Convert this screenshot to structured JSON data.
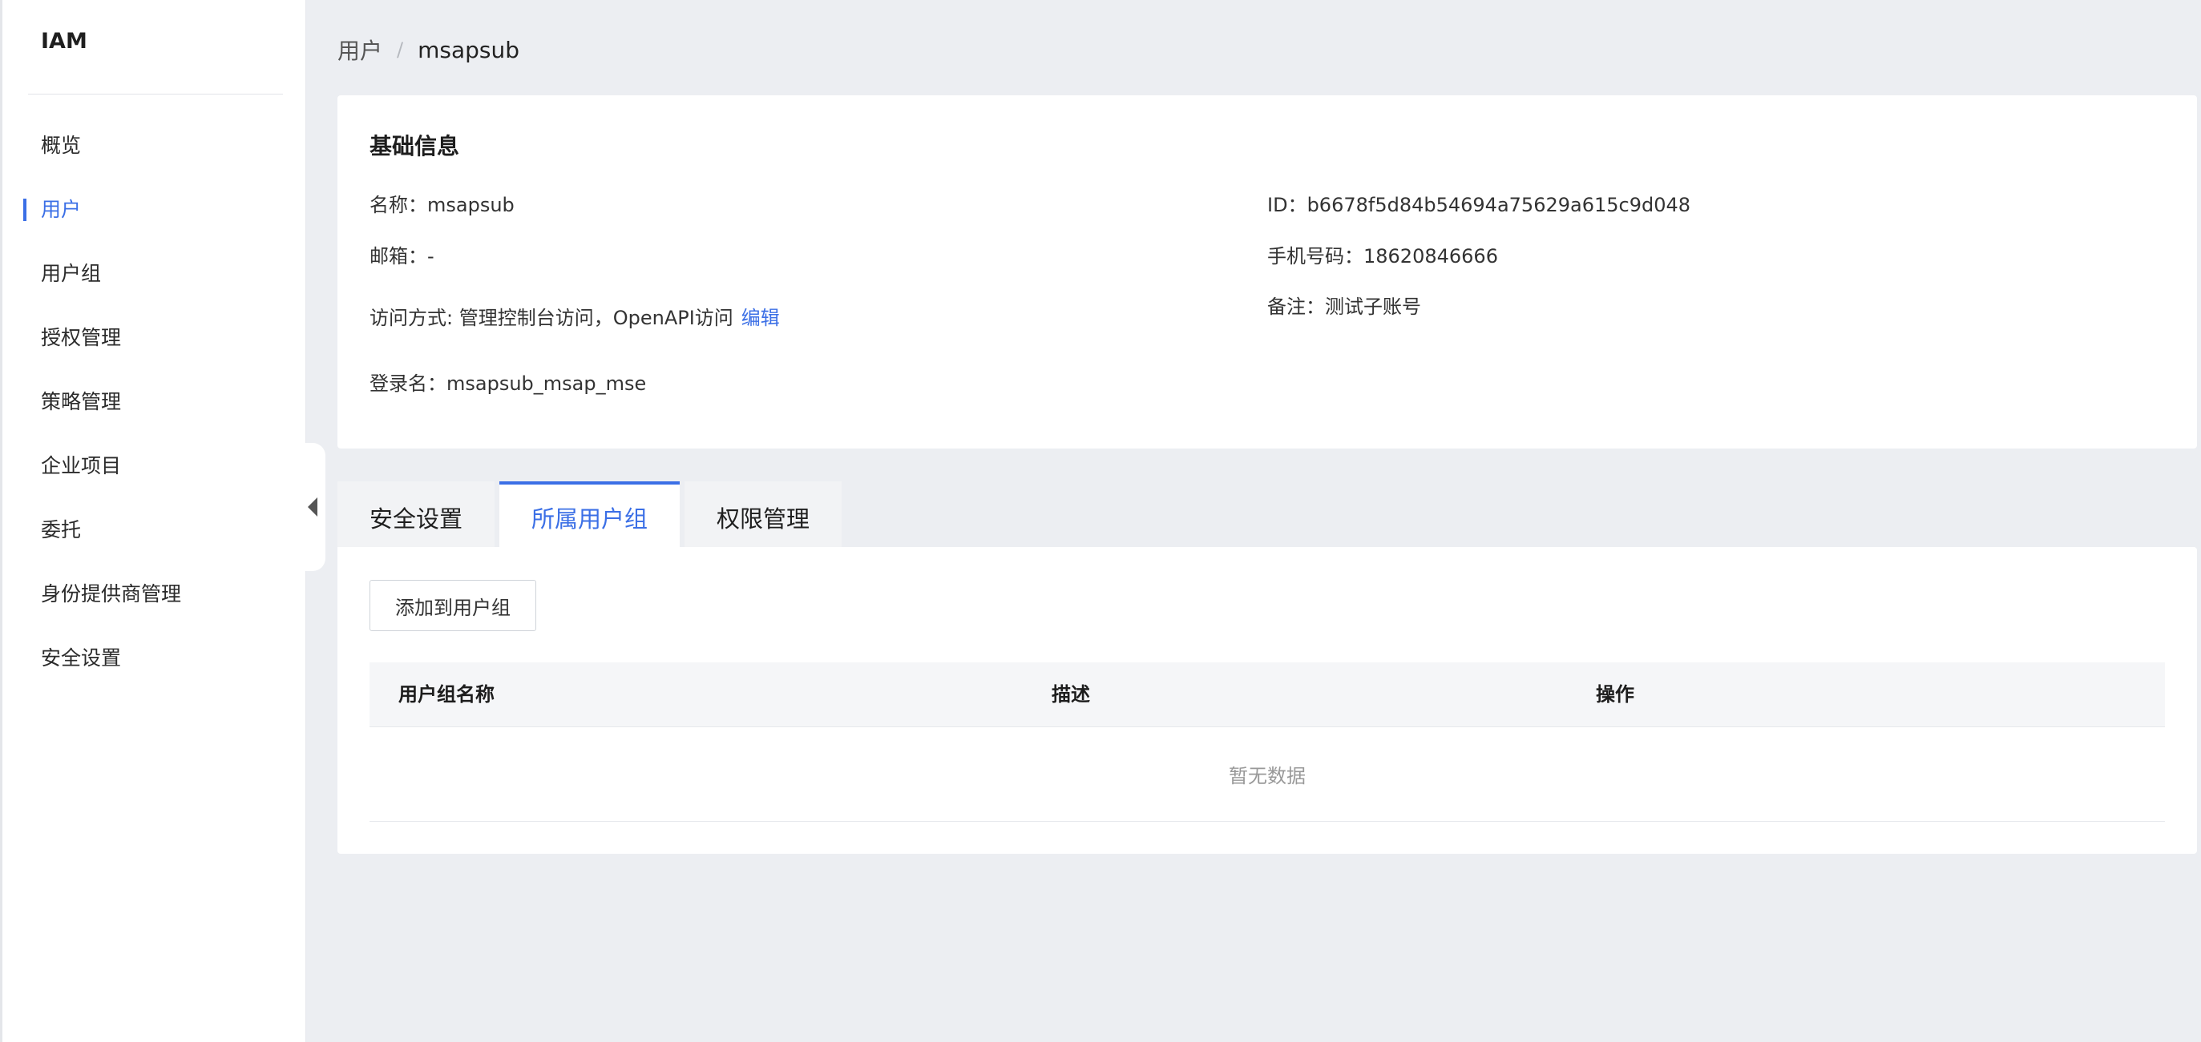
{
  "app": {
    "title": "IAM"
  },
  "sidebar": {
    "items": [
      {
        "label": "概览"
      },
      {
        "label": "用户"
      },
      {
        "label": "用户组"
      },
      {
        "label": "授权管理"
      },
      {
        "label": "策略管理"
      },
      {
        "label": "企业项目"
      },
      {
        "label": "委托"
      },
      {
        "label": "身份提供商管理"
      },
      {
        "label": "安全设置"
      }
    ],
    "active_index": 1,
    "collapse_icon": "caret-left-icon"
  },
  "breadcrumb": {
    "parent": "用户",
    "separator": "/",
    "current": "msapsub"
  },
  "basic_info": {
    "title": "基础信息",
    "name_label": "名称：",
    "name_value": "msapsub",
    "email_label": "邮箱：",
    "email_value": "-",
    "access_label": "访问方式: ",
    "access_value": "管理控制台访问，OpenAPI访问",
    "access_edit": "编辑",
    "login_label": "登录名：",
    "login_value": "msapsub_msap_mse",
    "id_label": "ID：",
    "id_value": "b6678f5d84b54694a75629a615c9d048",
    "phone_label": "手机号码：",
    "phone_value": "18620846666",
    "remark_label": "备注：",
    "remark_value": "测试子账号"
  },
  "tabs": [
    {
      "label": "安全设置"
    },
    {
      "label": "所属用户组"
    },
    {
      "label": "权限管理"
    }
  ],
  "active_tab": 1,
  "group_panel": {
    "add_button": "添加到用户组",
    "columns": [
      "用户组名称",
      "描述",
      "操作"
    ],
    "empty_text": "暂无数据"
  },
  "colors": {
    "accent": "#3b6fe6",
    "background": "#eceef2"
  }
}
